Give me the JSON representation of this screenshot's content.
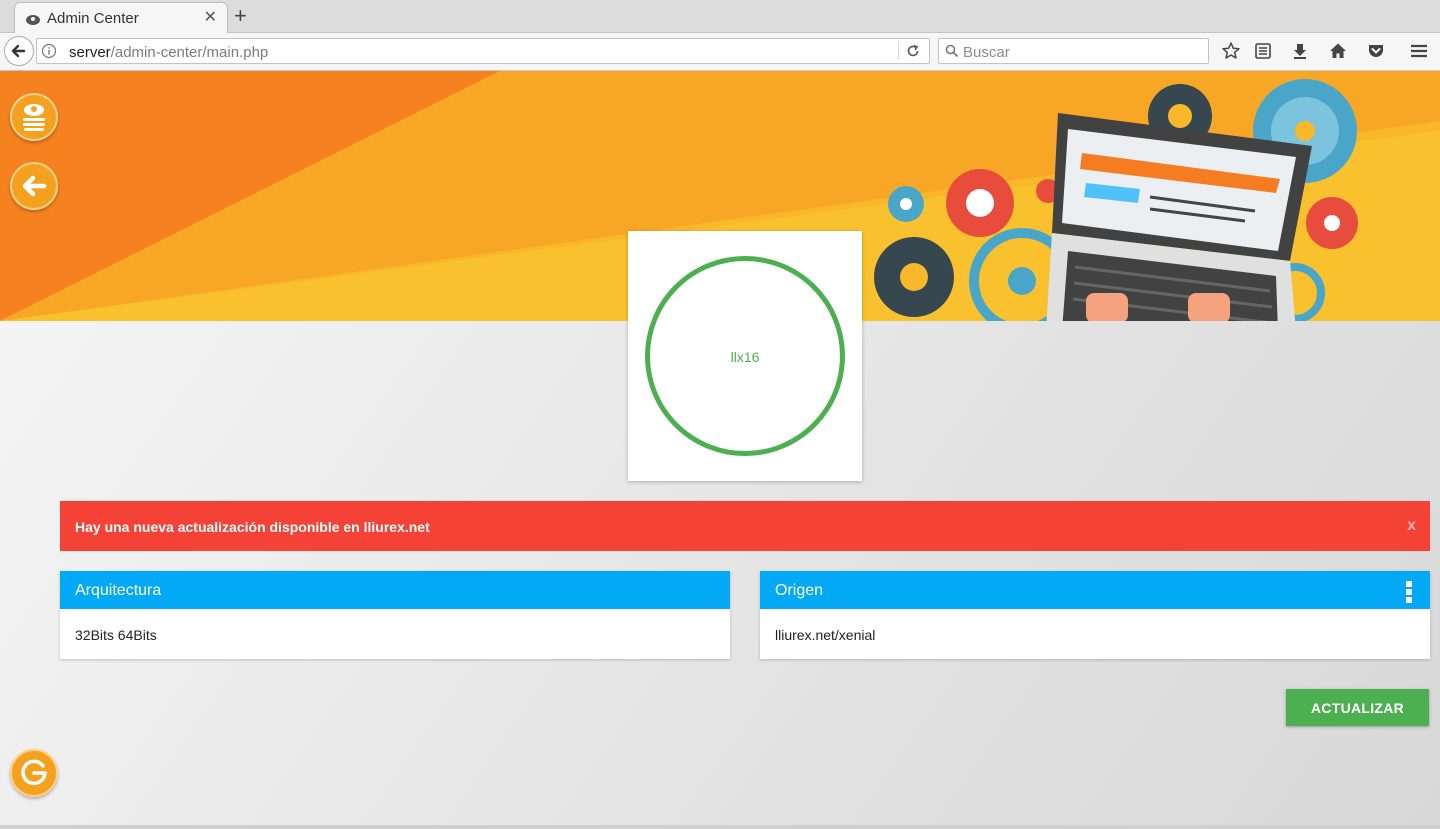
{
  "browser": {
    "tab_title": "Admin Center",
    "url_host": "server",
    "url_path": "/admin-center/main.php",
    "search_placeholder": "Buscar"
  },
  "toolbar_icons": [
    "bookmark-star-icon",
    "reading-list-icon",
    "downloads-icon",
    "home-icon",
    "pocket-icon",
    "menu-icon"
  ],
  "sidebar": {
    "buttons": [
      {
        "name": "lliurex-menu-button",
        "icon": "lliurex-logo-icon"
      },
      {
        "name": "back-button",
        "icon": "arrow-left-icon"
      }
    ],
    "logout_icon": "power-icon"
  },
  "status_card": {
    "label": "llx16",
    "ring_color": "#4caf50"
  },
  "alert": {
    "message": "Hay una nueva actualización disponible en lliurex.net",
    "close_label": "x",
    "color": "#f44336"
  },
  "panels": [
    {
      "title": "Arquitectura",
      "body": "32Bits 64Bits"
    },
    {
      "title": "Origen",
      "body": "lliurex.net/xenial"
    }
  ],
  "actions": {
    "update_label": "ACTUALIZAR"
  },
  "colors": {
    "accent_blue": "#03a9f4",
    "orange": "#f5a120",
    "green": "#4caf50"
  }
}
